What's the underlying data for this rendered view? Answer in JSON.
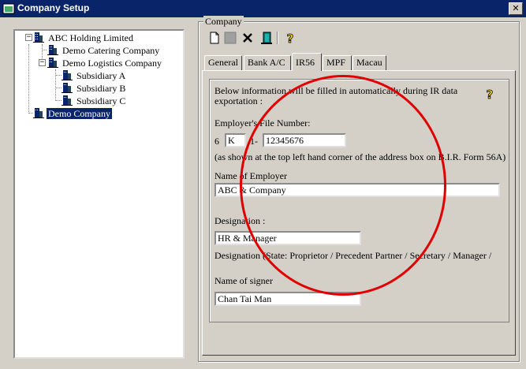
{
  "window": {
    "title": "Company Setup",
    "close_symbol": "✕"
  },
  "tree": {
    "root": "ABC Holding Limited",
    "catering": "Demo Catering Company",
    "logistics": "Demo Logistics Company",
    "sub_a": "Subsidiary A",
    "sub_b": "Subsidiary B",
    "sub_c": "Subsidiary C",
    "demo": "Demo Company",
    "expand_symbol": "−"
  },
  "company_group": {
    "label": "Company"
  },
  "toolbar": {
    "icons": [
      "new-document-icon",
      "save-icon",
      "delete-icon",
      "exit-door-icon",
      "help-icon"
    ]
  },
  "tabs": {
    "general": "General",
    "bank": "Bank A/C",
    "ir56": "IR56",
    "mpf": "MPF",
    "macau": "Macau",
    "active": "IR56"
  },
  "ir56": {
    "info_line1": "Below information will be filled in automatically during IR data",
    "info_line2": "exportation :",
    "file_number_label": "Employer's File Number:",
    "file_prefix": "6",
    "file_letter": "K",
    "file_dash": "1-",
    "file_number": "12345676",
    "file_note": "(as shown at the top left hand corner of the address box on B.I.R. Form 56A)",
    "employer_label": "Name of Employer",
    "employer_value": "ABC & Company",
    "designation_label": "Designation :",
    "designation_value": "HR & Manager",
    "designation_note": "Designation (State: Proprietor / Precedent Partner / Secretary / Manager /",
    "signer_label": "Name of signer",
    "signer_value": "Chan Tai Man"
  },
  "annotation": {
    "color": "#e00000"
  }
}
